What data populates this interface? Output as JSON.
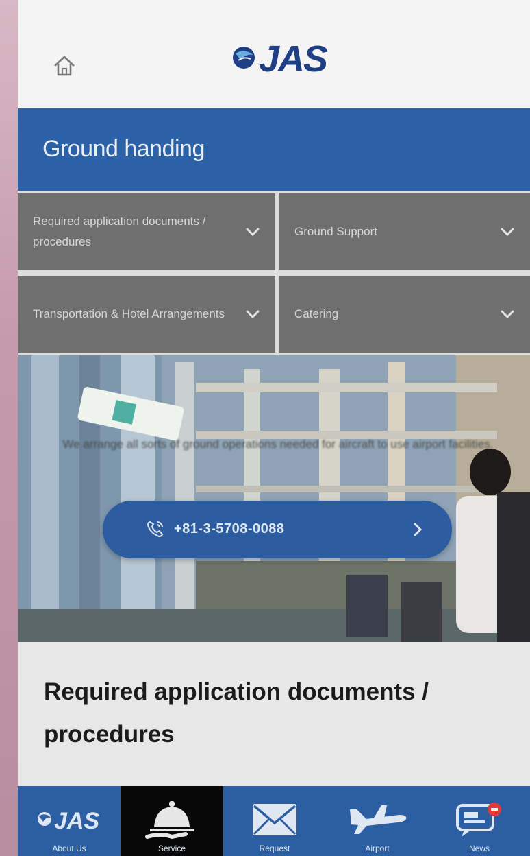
{
  "header": {
    "logo_text": "JAS",
    "home_icon": "home-icon"
  },
  "section": {
    "title": "Ground handing"
  },
  "menu": {
    "items": [
      {
        "label": "Required application documents / procedures",
        "icon": "chevron-down-icon"
      },
      {
        "label": "Ground Support",
        "icon": "chevron-down-icon"
      },
      {
        "label": "Transportation & Hotel Arrangements",
        "icon": "chevron-down-icon"
      },
      {
        "label": "Catering",
        "icon": "chevron-down-icon"
      }
    ]
  },
  "hero": {
    "text": "We arrange all sorts of ground operations needed for aircraft to use airport facilities.",
    "phone": "+81-3-5708-0088",
    "phone_icon": "phone-icon",
    "arrow_icon": "chevron-right-icon"
  },
  "content": {
    "heading": "Required application documents / procedures"
  },
  "tabbar": {
    "tabs": [
      {
        "label": "About Us",
        "icon": "jas-logo-icon"
      },
      {
        "label": "Service",
        "icon": "service-bell-icon"
      },
      {
        "label": "Request",
        "icon": "envelope-icon"
      },
      {
        "label": "Airport",
        "icon": "airplane-icon"
      },
      {
        "label": "News",
        "icon": "news-chat-icon"
      }
    ]
  },
  "colors": {
    "brand_blue": "#2b61a6",
    "menu_gray": "#6f6f6f",
    "active_tab": "#080808"
  }
}
